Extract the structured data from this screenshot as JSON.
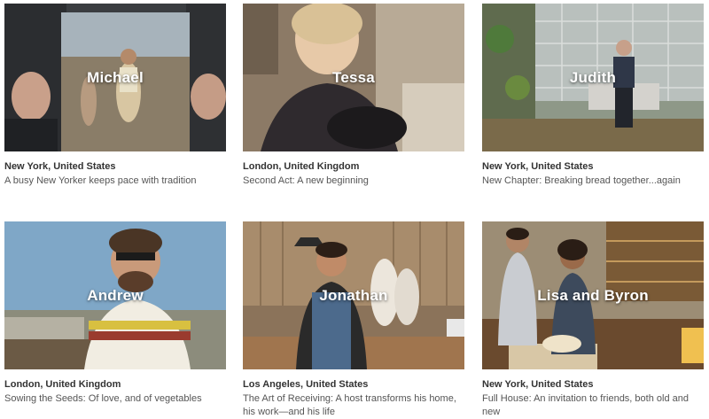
{
  "stories": [
    {
      "name": "Michael",
      "location": "New York, United States",
      "title": "A busy New Yorker keeps pace with tradition"
    },
    {
      "name": "Tessa",
      "location": "London, United Kingdom",
      "title": "Second Act: A new beginning"
    },
    {
      "name": "Judith",
      "location": "New York, United States",
      "title": "New Chapter: Breaking bread together...again"
    },
    {
      "name": "Andrew",
      "location": "London, United Kingdom",
      "title": "Sowing the Seeds: Of love, and of vegetables"
    },
    {
      "name": "Jonathan",
      "location": "Los Angeles, United States",
      "title": "The Art of Receiving: A host transforms his home, his work—and his life"
    },
    {
      "name": "Lisa and Byron",
      "location": "New York, United States",
      "title": "Full House: An invitation to friends, both old and new"
    }
  ]
}
